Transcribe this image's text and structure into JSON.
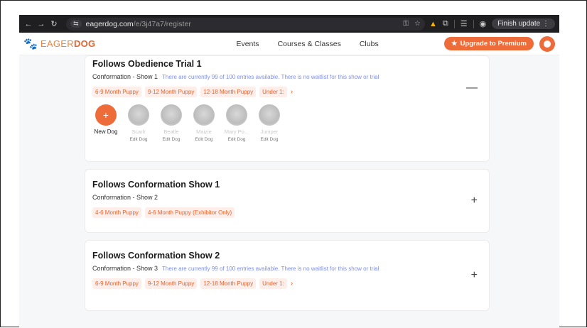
{
  "browser": {
    "url_host": "eagerdog.com",
    "url_path": "/e/3j47a7/register",
    "finish_update": "Finish update"
  },
  "site": {
    "logo_text_1": "EAGER",
    "logo_text_2": "DOG",
    "nav": [
      "Events",
      "Courses & Classes",
      "Clubs"
    ],
    "upgrade_label": "Upgrade to Premium"
  },
  "cards": [
    {
      "title": "Follows Obedience Trial 1",
      "sub": "Conformation - Show 1",
      "note": "There are currently 99 of 100 entries available. There is no waitlist for this show or trial",
      "tags": [
        "6-9 Month Puppy",
        "9-12 Month Puppy",
        "12-18 Month Puppy",
        "Under 1:"
      ],
      "toggle": "—"
    },
    {
      "title": "Follows Conformation Show 1",
      "sub": "Conformation - Show 2",
      "note": "",
      "tags": [
        "4-6 Month Puppy",
        "4-6 Month Puppy (Exhibitor Only)"
      ],
      "toggle": "+"
    },
    {
      "title": "Follows Conformation Show 2",
      "sub": "Conformation - Show 3",
      "note": "There are currently 99 of 100 entries available. There is no waitlist for this show or trial",
      "tags": [
        "6-9 Month Puppy",
        "9-12 Month Puppy",
        "12-18 Month Puppy",
        "Under 1:"
      ],
      "toggle": "+"
    }
  ],
  "dogs": {
    "new_label": "New Dog",
    "edit_label": "Edit Dog",
    "names": [
      "Scarlr",
      "Beatle",
      "Maizie",
      "Mary Po...",
      "Juniper"
    ]
  },
  "colors": {
    "accent": "#ee6b3a",
    "note": "#7e8fe6"
  }
}
